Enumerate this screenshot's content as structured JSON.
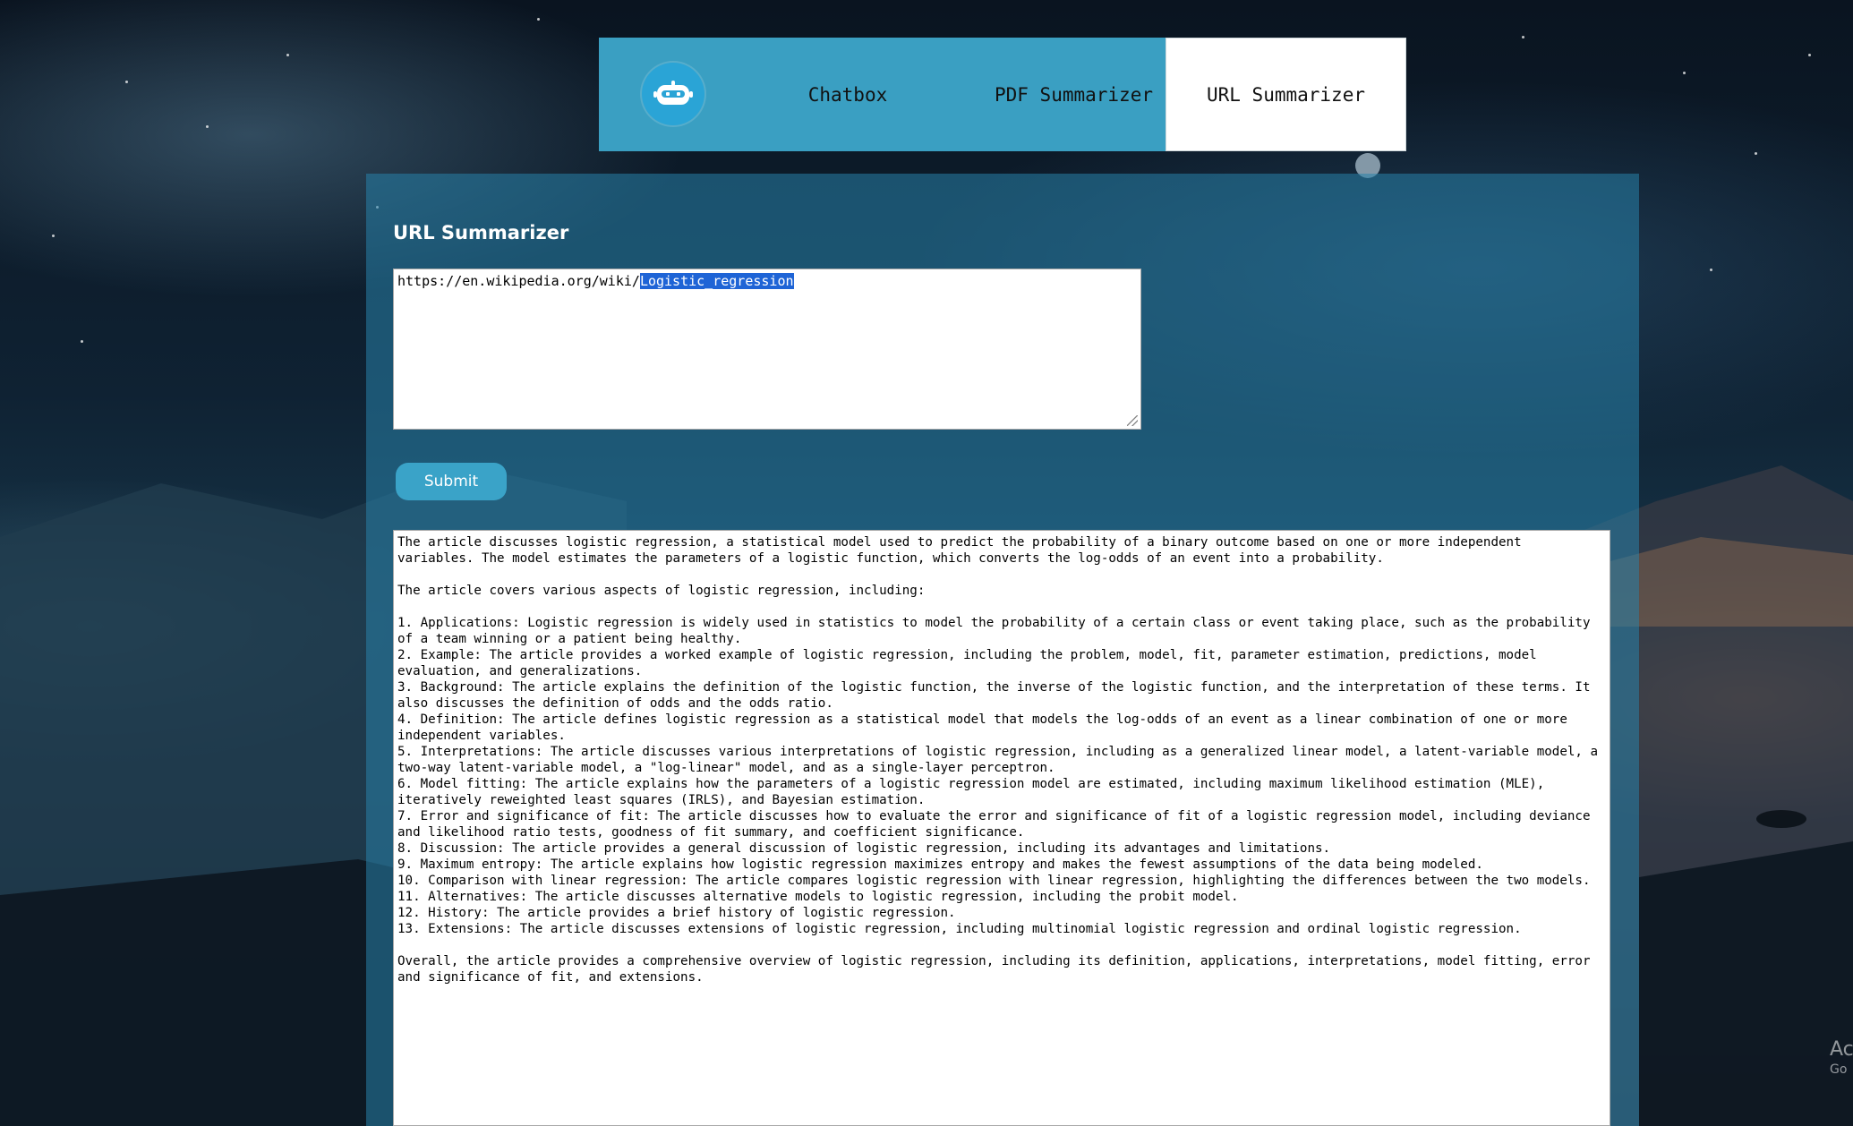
{
  "nav": {
    "logo_icon": "robot-icon",
    "tabs": [
      {
        "label": "Chatbox"
      },
      {
        "label": "PDF Summarizer"
      },
      {
        "label": "URL Summarizer",
        "active": true
      }
    ]
  },
  "main": {
    "title": "URL Summarizer",
    "url_input": {
      "prefix": "https://en.wikipedia.org/wiki/",
      "selected": "Logistic_regression"
    },
    "submit_label": "Submit",
    "output_text": "The article discusses logistic regression, a statistical model used to predict the probability of a binary outcome based on one or more independent\nvariables. The model estimates the parameters of a logistic function, which converts the log-odds of an event into a probability.\n\nThe article covers various aspects of logistic regression, including:\n\n1. Applications: Logistic regression is widely used in statistics to model the probability of a certain class or event taking place, such as the probability\nof a team winning or a patient being healthy.\n2. Example: The article provides a worked example of logistic regression, including the problem, model, fit, parameter estimation, predictions, model\nevaluation, and generalizations.\n3. Background: The article explains the definition of the logistic function, the inverse of the logistic function, and the interpretation of these terms. It\nalso discusses the definition of odds and the odds ratio.\n4. Definition: The article defines logistic regression as a statistical model that models the log-odds of an event as a linear combination of one or more\nindependent variables.\n5. Interpretations: The article discusses various interpretations of logistic regression, including as a generalized linear model, a latent-variable model, a\ntwo-way latent-variable model, a \"log-linear\" model, and as a single-layer perceptron.\n6. Model fitting: The article explains how the parameters of a logistic regression model are estimated, including maximum likelihood estimation (MLE),\niteratively reweighted least squares (IRLS), and Bayesian estimation.\n7. Error and significance of fit: The article discusses how to evaluate the error and significance of fit of a logistic regression model, including deviance\nand likelihood ratio tests, goodness of fit summary, and coefficient significance.\n8. Discussion: The article provides a general discussion of logistic regression, including its advantages and limitations.\n9. Maximum entropy: The article explains how logistic regression maximizes entropy and makes the fewest assumptions of the data being modeled.\n10. Comparison with linear regression: The article compares logistic regression with linear regression, highlighting the differences between the two models.\n11. Alternatives: The article discusses alternative models to logistic regression, including the probit model.\n12. History: The article provides a brief history of logistic regression.\n13. Extensions: The article discusses extensions of logistic regression, including multinomial logistic regression and ordinal logistic regression.\n\nOverall, the article provides a comprehensive overview of logistic regression, including its definition, applications, interpretations, model fitting, error\nand significance of fit, and extensions."
  },
  "watermark": {
    "line1": "Ac",
    "line2": "Go"
  },
  "colors": {
    "nav_bg": "#3a9fc2",
    "active_tab_bg": "#ffffff",
    "button_bg": "#3aa3c8",
    "selection": "#1e64d6"
  }
}
